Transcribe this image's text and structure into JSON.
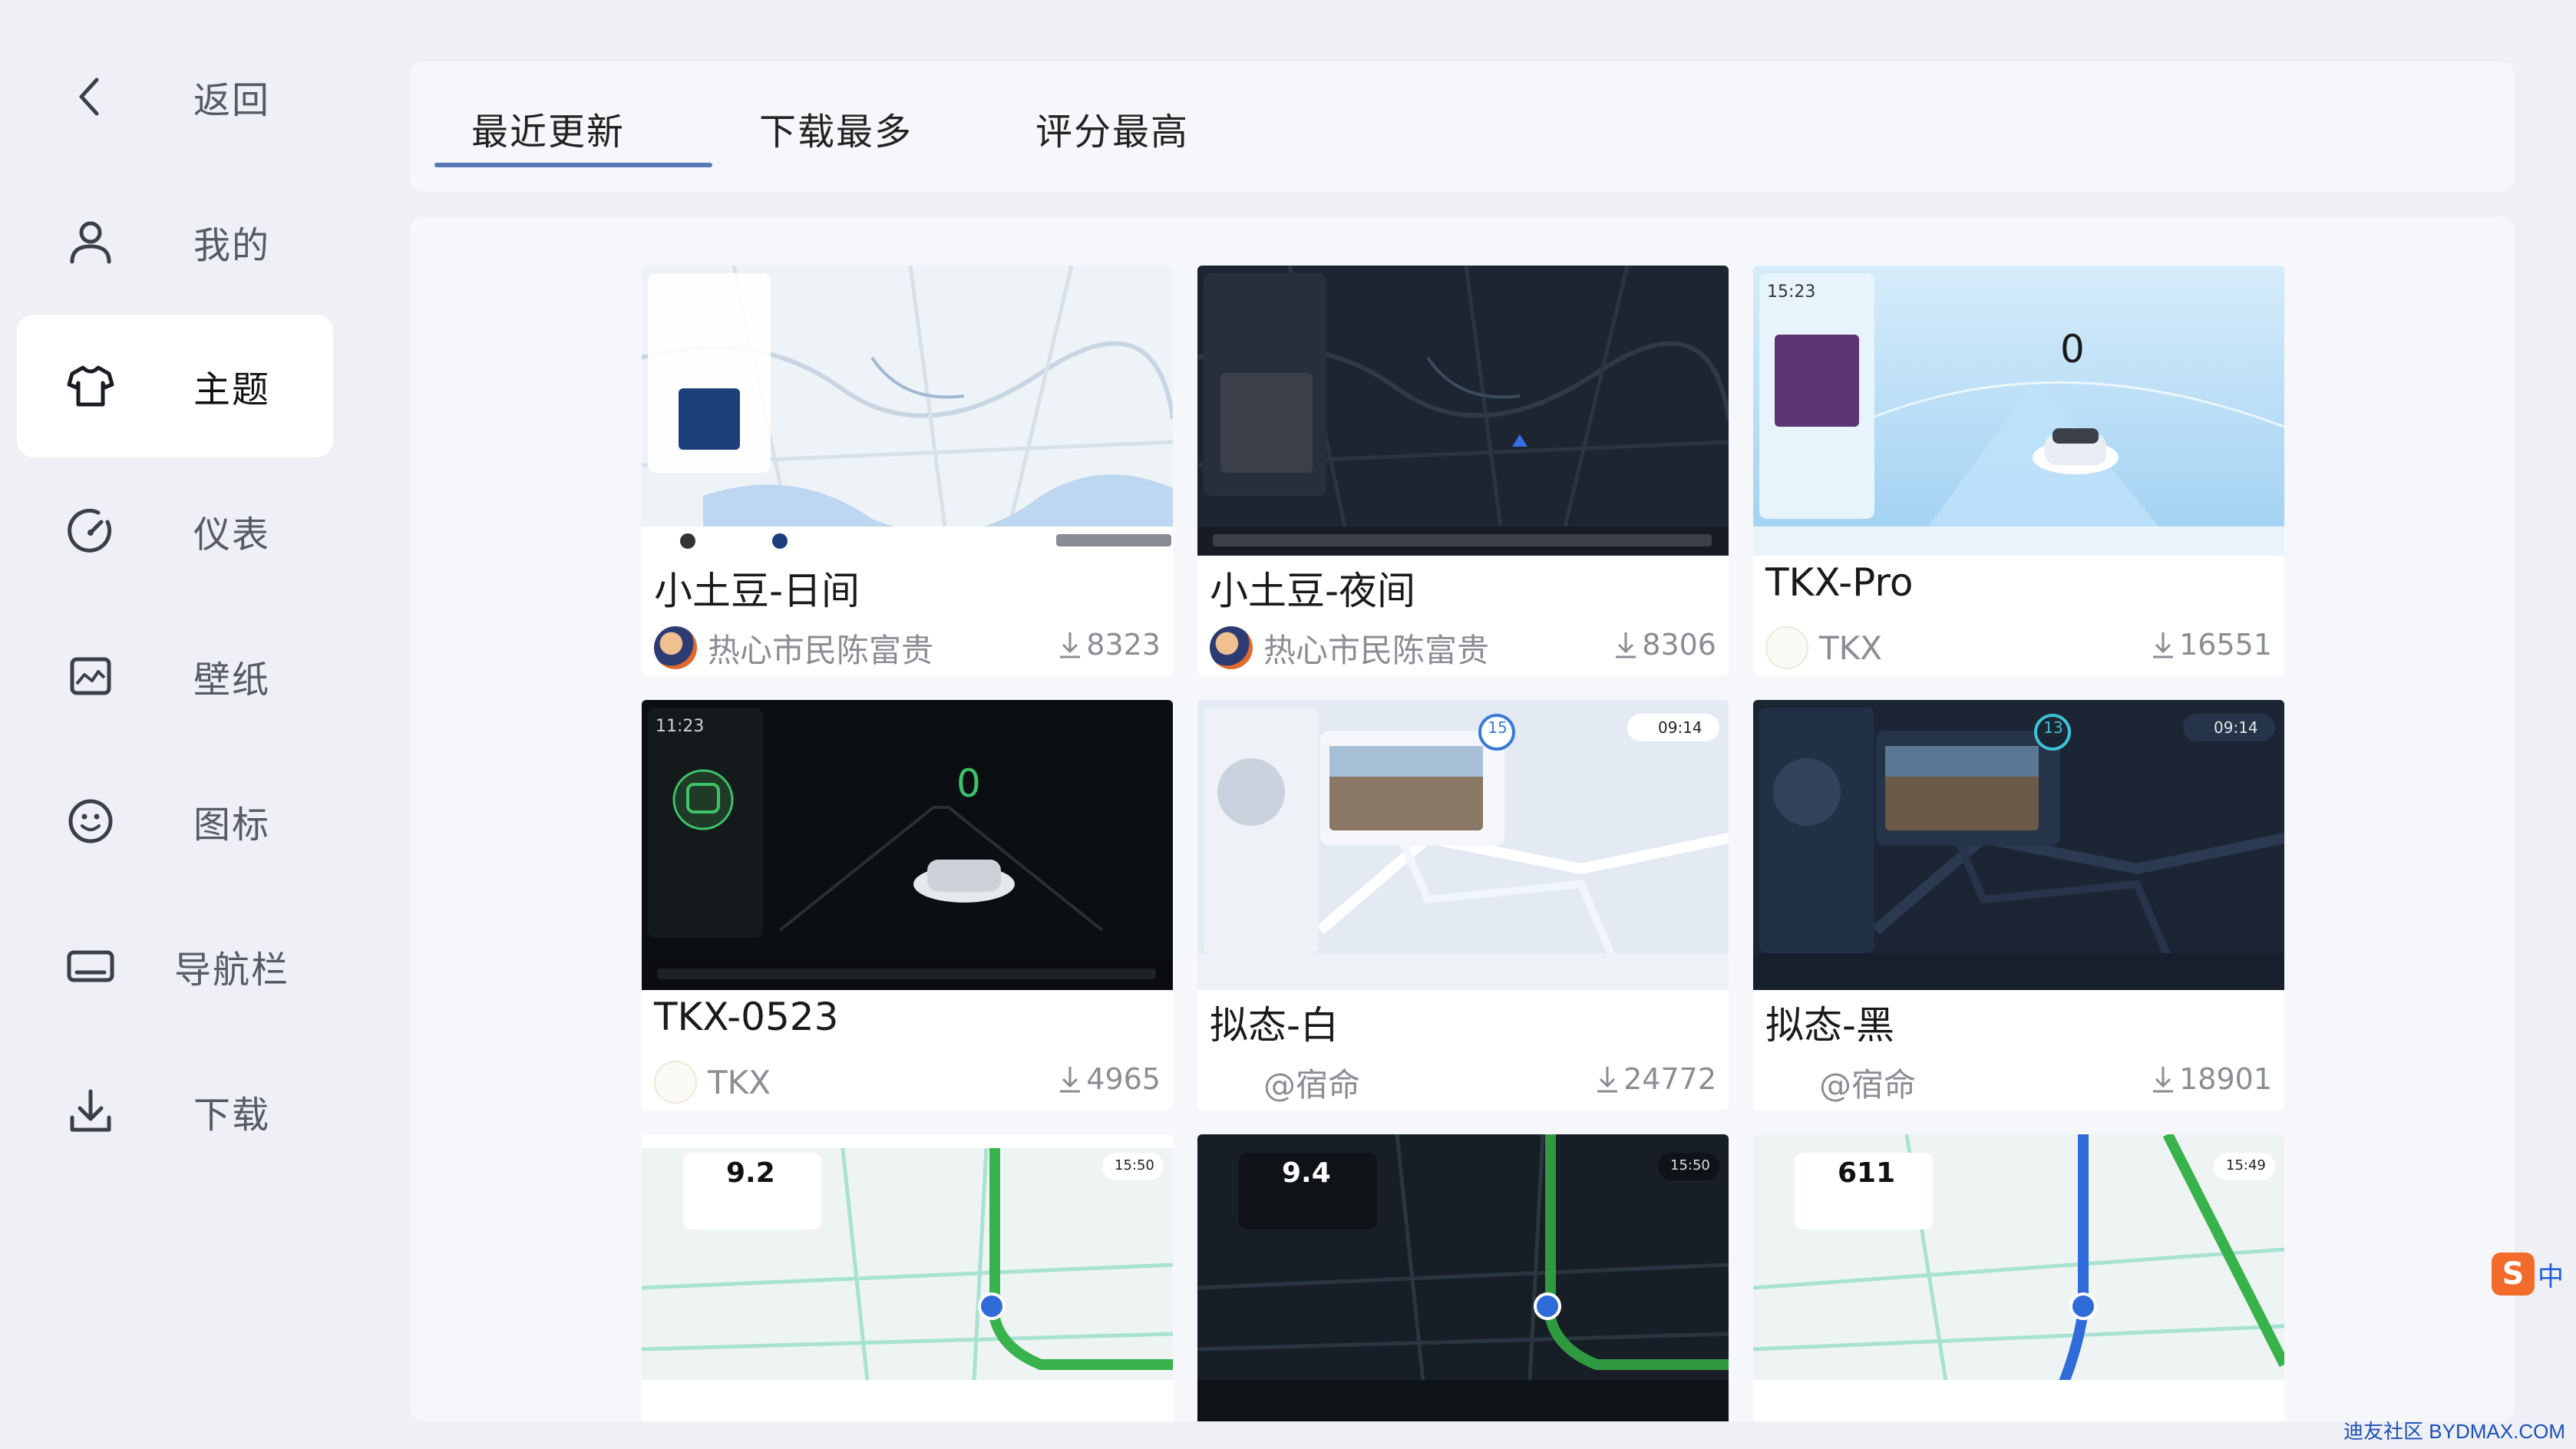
{
  "sidebar": {
    "items": [
      {
        "label": "返回",
        "icon": "back-arrow-icon"
      },
      {
        "label": "我的",
        "icon": "user-icon"
      },
      {
        "label": "主题",
        "icon": "tshirt-icon",
        "active": true
      },
      {
        "label": "仪表",
        "icon": "gauge-icon"
      },
      {
        "label": "壁纸",
        "icon": "wallpaper-icon"
      },
      {
        "label": "图标",
        "icon": "smiley-icon"
      },
      {
        "label": "导航栏",
        "icon": "navbar-icon"
      },
      {
        "label": "下载",
        "icon": "download-icon"
      }
    ]
  },
  "tabs": [
    {
      "label": "最近更新",
      "active": true
    },
    {
      "label": "下载最多",
      "active": false
    },
    {
      "label": "评分最高",
      "active": false
    }
  ],
  "themes": [
    {
      "title": "小土豆-日间",
      "author": "热心市民陈富贵",
      "downloads": "8323",
      "style": "map-day"
    },
    {
      "title": "小土豆-夜间",
      "author": "热心市民陈富贵",
      "downloads": "8306",
      "style": "map-night"
    },
    {
      "title": "TKX-Pro",
      "author": "TKX",
      "downloads": "16551",
      "style": "car-light"
    },
    {
      "title": "TKX-0523",
      "author": "TKX",
      "downloads": "4965",
      "style": "car-dark"
    },
    {
      "title": "拟态-白",
      "author": "@宿命",
      "downloads": "24772",
      "style": "skeuo-light"
    },
    {
      "title": "拟态-黑",
      "author": "@宿命",
      "downloads": "18901",
      "style": "skeuo-dark"
    },
    {
      "title": "",
      "author": "",
      "downloads": "",
      "style": "nav-day"
    },
    {
      "title": "",
      "author": "",
      "downloads": "",
      "style": "nav-night"
    },
    {
      "title": "",
      "author": "",
      "downloads": "",
      "style": "nav-day2"
    }
  ],
  "thumb_text": {
    "speed_zero": "0",
    "card1_time": "15:23",
    "card4_time": "11:23",
    "nav1_dist": "9.2",
    "nav2_dist": "9.4",
    "nav3_dist": "611",
    "nav_time1": "15:50",
    "nav_time3": "15:49",
    "skeuo_light_time": "09:14",
    "skeuo_light_badge": "15",
    "skeuo_dark_badge": "13"
  },
  "ime": {
    "label": "中"
  },
  "watermark": "迪友社区 BYDMAX.COM",
  "colors": {
    "accent": "#5978b8",
    "background": "#eef0f6",
    "panel": "#f6f7fa"
  }
}
